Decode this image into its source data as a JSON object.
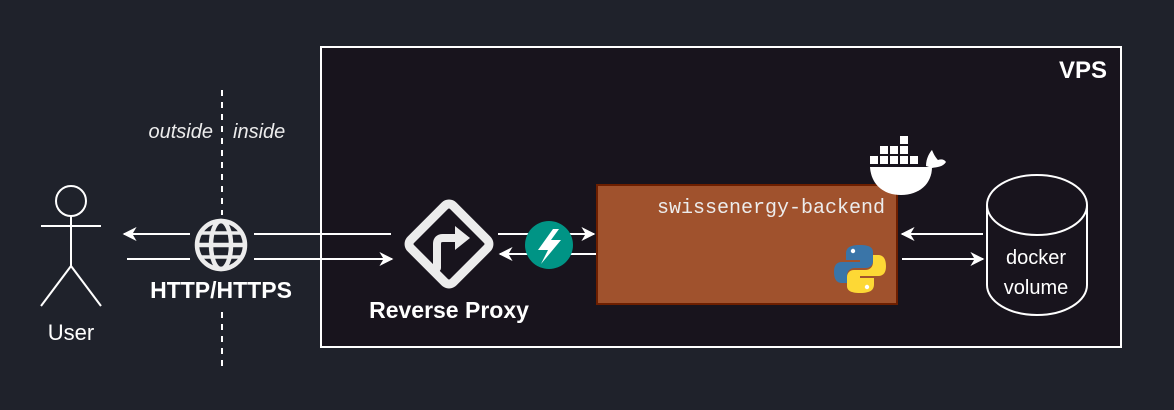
{
  "labels": {
    "vps": "VPS",
    "outside": "outside",
    "inside": "inside",
    "user": "User",
    "http": "HTTP/HTTPS",
    "reverse_proxy": "Reverse Proxy",
    "backend": "swissenergy-backend",
    "volume_line1": "docker",
    "volume_line2": "volume"
  },
  "icons": {
    "globe": "globe-icon",
    "reverse_proxy": "reverse-proxy-icon",
    "fastapi": "fastapi-icon",
    "docker": "docker-whale-icon",
    "python": "python-icon"
  },
  "colors": {
    "background": "#1f222b",
    "vps_fill": "#18141d",
    "stroke": "#ffffff",
    "backend_fill": "#a0522d",
    "backend_stroke": "#6d1f00",
    "fastapi": "#009485",
    "python_blue": "#3a75a8",
    "python_yellow": "#fdd835"
  }
}
